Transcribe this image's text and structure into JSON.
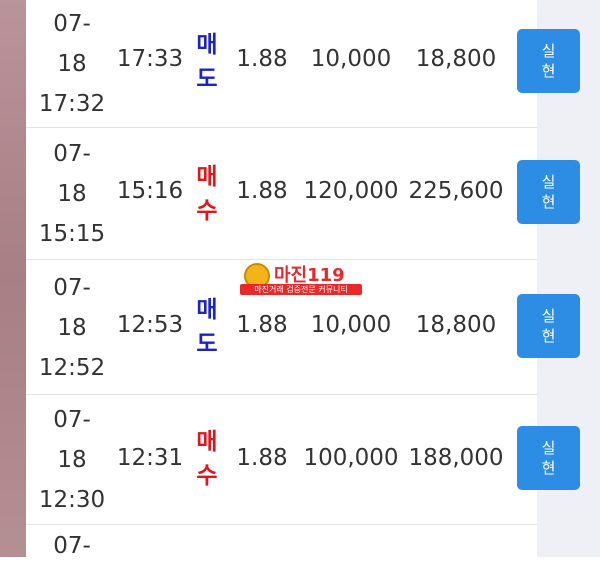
{
  "trades": [
    {
      "month": "07-",
      "day": "18",
      "date_time": "17:32",
      "time": "17:33",
      "side_c1": "매",
      "side_c2": "도",
      "side_color": "#1b22c8",
      "price": "1.88",
      "qty": "10,000",
      "amount": "18,800",
      "action_c1": "실",
      "action_c2": "현"
    },
    {
      "month": "07-",
      "day": "18",
      "date_time": "15:15",
      "time": "15:16",
      "side_c1": "매",
      "side_c2": "수",
      "side_color": "#e0161b",
      "price": "1.88",
      "qty": "120,000",
      "amount": "225,600",
      "action_c1": "실",
      "action_c2": "현"
    },
    {
      "month": "07-",
      "day": "18",
      "date_time": "12:52",
      "time": "12:53",
      "side_c1": "매",
      "side_c2": "도",
      "side_color": "#1b22c8",
      "price": "1.88",
      "qty": "10,000",
      "amount": "18,800",
      "action_c1": "실",
      "action_c2": "현"
    },
    {
      "month": "07-",
      "day": "18",
      "date_time": "12:30",
      "time": "12:31",
      "side_c1": "매",
      "side_c2": "수",
      "side_color": "#e0161b",
      "price": "1.88",
      "qty": "100,000",
      "amount": "188,000",
      "action_c1": "실",
      "action_c2": "현"
    }
  ],
  "partial_row": {
    "month": "07-"
  },
  "watermark": {
    "title": "마진119",
    "subtitle": "마진거래 검증전문 커뮤니티"
  }
}
